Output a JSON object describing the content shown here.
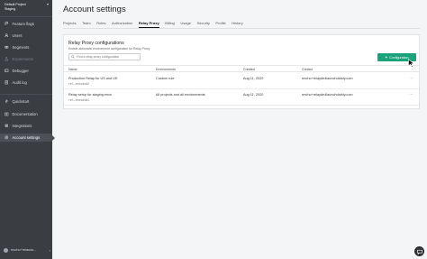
{
  "sidebar": {
    "project": {
      "line1": "Default Project",
      "line2": "Staging"
    },
    "items": [
      {
        "label": "Feature flags"
      },
      {
        "label": "Users"
      },
      {
        "label": "Segments"
      },
      {
        "label": "Experiments"
      },
      {
        "label": "Debugger"
      },
      {
        "label": "Audit log"
      },
      {
        "label": "Quickstart"
      },
      {
        "label": "Documentation"
      },
      {
        "label": "Integrations"
      },
      {
        "label": "Account settings"
      }
    ],
    "user": {
      "label": "rmcho+relaudc..."
    }
  },
  "header": {
    "title": "Account settings",
    "tabs": [
      "Projects",
      "Team",
      "Roles",
      "Authorization",
      "Relay Proxy",
      "Billing",
      "Usage",
      "Security",
      "Profile",
      "History"
    ],
    "active_tab": "Relay Proxy"
  },
  "panel": {
    "title": "Relay Proxy configurations",
    "description": "Enable automatic environment configuration for Relay Proxy.",
    "search_placeholder": "Find a relay proxy configuration",
    "add_button": "Configuration",
    "columns": [
      "Name",
      "Environments",
      "Created",
      "Creator"
    ],
    "rows": [
      {
        "name": "Production Relay for US and UK",
        "id": "rel-exxxdsd2",
        "environments": "Custom rule",
        "created": "Aug 11, 2020",
        "creator": "rmcho+relayde4launchdarkly.com"
      },
      {
        "name": "Relay setup for staging envs",
        "id": "rel-exxxdsb1",
        "environments": "All projects and all environments",
        "created": "Aug 11, 2020",
        "creator": "rmcho+relayde4launchdarkly.com"
      }
    ]
  },
  "colors": {
    "sidebar": "#3a3d42",
    "accent": "#1aa37a",
    "background": "#f4f5f6"
  },
  "icons": [
    "flag-icon",
    "users-icon",
    "segments-icon",
    "experiments-icon",
    "debugger-icon",
    "audit-log-icon",
    "quickstart-icon",
    "documentation-icon",
    "integrations-icon",
    "settings-icon",
    "search-icon",
    "plus-icon",
    "more-icon",
    "help-icon"
  ]
}
